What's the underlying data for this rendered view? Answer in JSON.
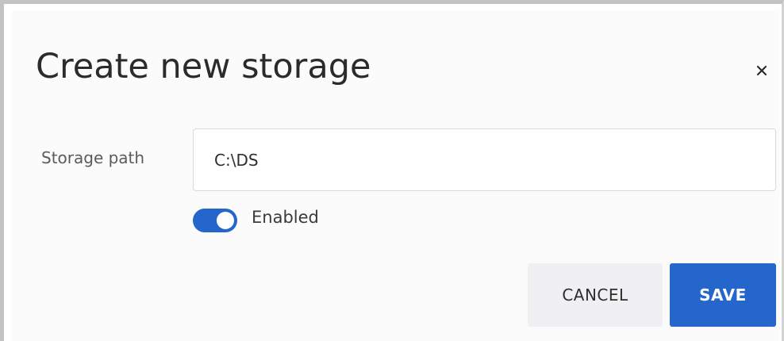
{
  "dialog": {
    "title": "Create new storage",
    "close_icon": "close-icon"
  },
  "form": {
    "storage_path_label": "Storage path",
    "storage_path_value": "C:\\DS",
    "enabled_toggle": {
      "label": "Enabled",
      "on": true
    }
  },
  "actions": {
    "cancel_label": "CANCEL",
    "save_label": "SAVE"
  },
  "colors": {
    "accent": "#2466cc",
    "cancel_bg": "#f0eff2",
    "title_text": "#2b2b2b"
  }
}
